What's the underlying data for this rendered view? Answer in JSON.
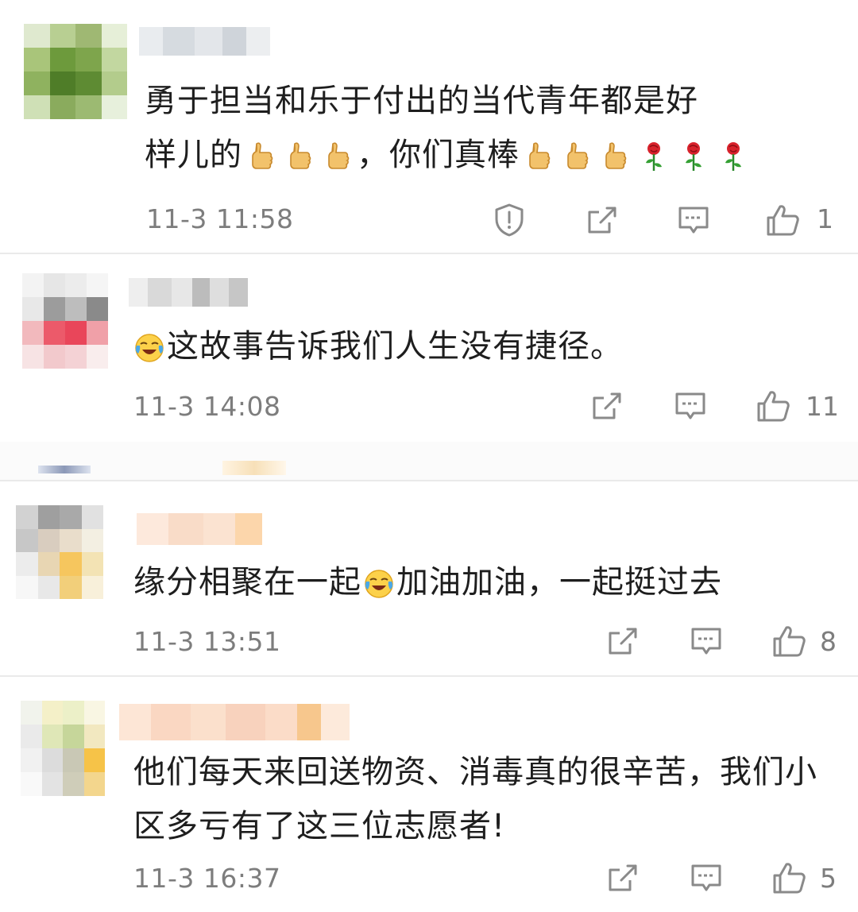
{
  "comments": [
    {
      "text_line1": "勇于担当和乐于付出的当代青年都是好",
      "text_line2_a": "样儿的",
      "text_line2_b": "，你们真棒",
      "time": "11-3 11:58",
      "likes": "1"
    },
    {
      "text": "这故事告诉我们人生没有捷径。",
      "time": "11-3 14:08",
      "likes": "11"
    },
    {
      "text_a": "缘分相聚在一起",
      "text_b": "加油加油，一起挺过去",
      "time": "11-3 13:51",
      "likes": "8"
    },
    {
      "text_line1": "他们每天来回送物资、消毒真的很辛苦，我们小",
      "text_line2": "区多亏有了这三位志愿者!",
      "time": "11-3 16:37",
      "likes": "5"
    }
  ],
  "icons": {
    "report": "report-shield-icon",
    "share": "share-icon",
    "reply": "reply-comment-icon",
    "like": "thumbs-up-icon",
    "thumbs_emoji": "thumbs-up-emoji-icon",
    "rose_emoji": "rose-emoji-icon",
    "cry_emoji": "laugh-cry-emoji-icon"
  },
  "colors": {
    "text": "#1e1e1e",
    "meta": "#7d7d7d",
    "divider": "#eaeaea",
    "icon": "#8a8a8a"
  }
}
